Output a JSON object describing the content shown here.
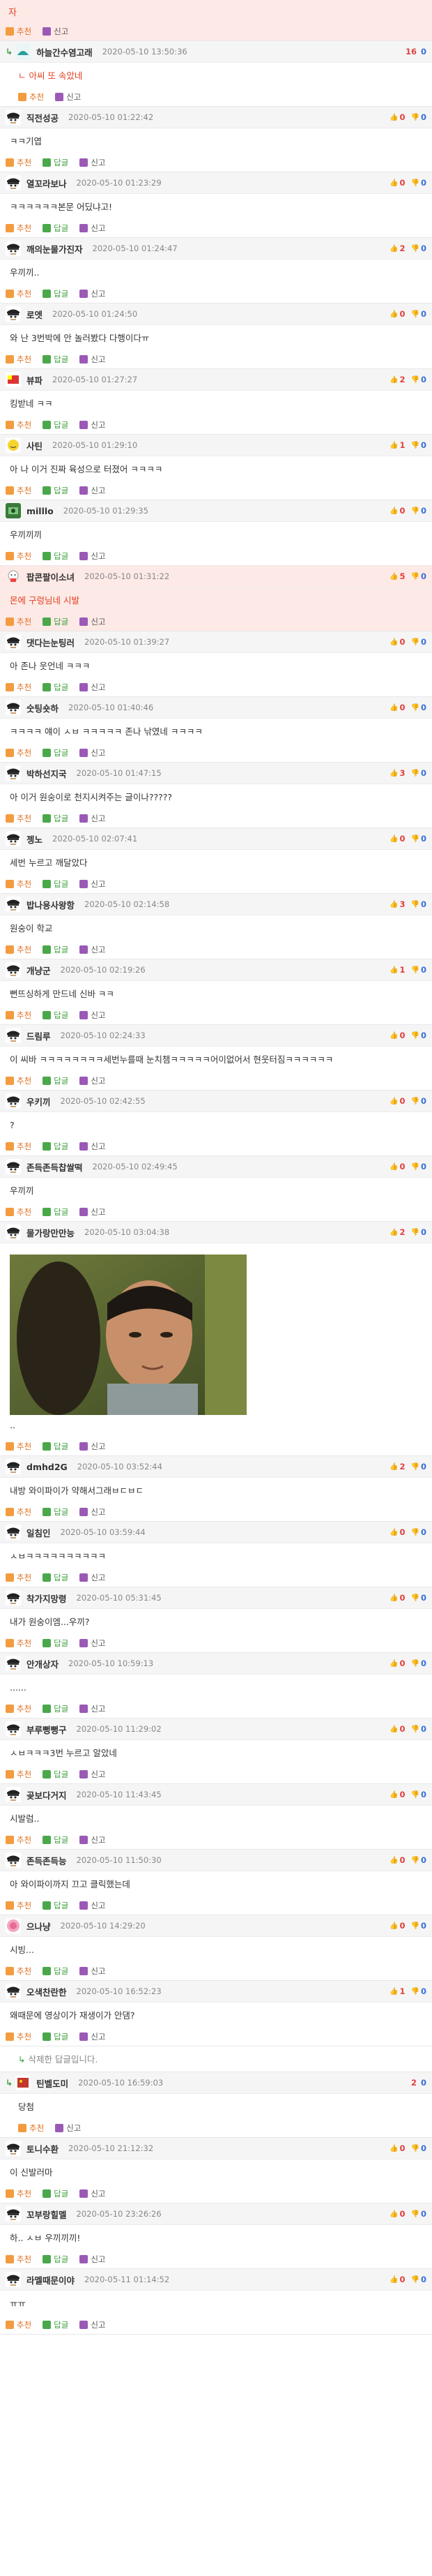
{
  "top_partial": {
    "text": "자"
  },
  "labels": {
    "recommend": "추천",
    "reply": "답글",
    "report": "신고"
  },
  "comments": [
    {
      "id": "c1",
      "reply": false,
      "highlight": true,
      "nick": "",
      "date": "",
      "votes": null,
      "count": null,
      "body": "",
      "actions": [
        "recommend",
        "report"
      ],
      "avatar": "none"
    },
    {
      "id": "c2",
      "reply": true,
      "highlight": false,
      "nick": "하늘간수염고래",
      "date": "2020-05-10 13:50:36",
      "count": "16",
      "count2": "0",
      "votes": "plain",
      "body": "ㄴ 아씨 또 속았네",
      "bodyClass": "red",
      "actions": [
        "recommend",
        "report"
      ],
      "avatar": "whale"
    },
    {
      "id": "c3",
      "nick": "직전성공",
      "date": "2020-05-10 01:22:42",
      "up": "0",
      "down": "0",
      "body": "ㅋㅋ기엽",
      "actions": [
        "recommend",
        "reply",
        "report"
      ],
      "avatar": "dark"
    },
    {
      "id": "c4",
      "nick": "열꼬라보나",
      "date": "2020-05-10 01:23:29",
      "up": "0",
      "down": "0",
      "body": "ㅋㅋㅋㅋㅋㅋ본문 어딨냐고!",
      "actions": [
        "recommend",
        "reply",
        "report"
      ],
      "avatar": "dark"
    },
    {
      "id": "c5",
      "nick": "깨의눈물가진자",
      "date": "2020-05-10 01:24:47",
      "up": "2",
      "down": "0",
      "body": "우끼끼..",
      "actions": [
        "recommend",
        "reply",
        "report"
      ],
      "avatar": "dark"
    },
    {
      "id": "c6",
      "nick": "로엣",
      "date": "2020-05-10 01:24:50",
      "up": "0",
      "down": "0",
      "body": "와 난 3번박에 안 놀러봤다 다행이다ㅠ",
      "actions": [
        "recommend",
        "reply",
        "report"
      ],
      "avatar": "dark"
    },
    {
      "id": "c7",
      "nick": "뷰파",
      "date": "2020-05-10 01:27:27",
      "up": "2",
      "down": "0",
      "body": "킹받네 ㅋㅋ",
      "actions": [
        "recommend",
        "reply",
        "report"
      ],
      "avatar": "flag"
    },
    {
      "id": "c8",
      "nick": "사틴",
      "date": "2020-05-10 01:29:10",
      "up": "1",
      "down": "0",
      "body": "아 나 이거 진짜 육성으로 터졌어 ㅋㅋㅋㅋ",
      "actions": [
        "recommend",
        "reply",
        "report"
      ],
      "avatar": "yellow"
    },
    {
      "id": "c9",
      "nick": "milllo",
      "date": "2020-05-10 01:29:35",
      "up": "0",
      "down": "0",
      "body": "우끼끼끼",
      "actions": [
        "recommend",
        "reply",
        "report"
      ],
      "avatar": "green"
    },
    {
      "id": "c10",
      "highlight": true,
      "nick": "팝콘팔이소녀",
      "date": "2020-05-10 01:31:22",
      "up": "5",
      "down": "0",
      "body": "몬에 구렁님네 시발",
      "bodyClass": "red",
      "actions": [
        "recommend",
        "reply",
        "report"
      ],
      "avatar": "popcorn"
    },
    {
      "id": "c11",
      "nick": "댓다는눈팅러",
      "date": "2020-05-10 01:39:27",
      "up": "0",
      "down": "0",
      "body": "아 존나 웃언네 ㅋㅋㅋ",
      "actions": [
        "recommend",
        "reply",
        "report"
      ],
      "avatar": "dark"
    },
    {
      "id": "c12",
      "nick": "숫팅숏하",
      "date": "2020-05-10 01:40:46",
      "up": "0",
      "down": "0",
      "body": "ㅋㅋㅋㅋ 얘이 ㅅㅂ ㅋㅋㅋㅋㅋ 존나 낚였네 ㅋㅋㅋㅋ",
      "actions": [
        "recommend",
        "reply",
        "report"
      ],
      "avatar": "dark"
    },
    {
      "id": "c13",
      "nick": "박하선지국",
      "date": "2020-05-10 01:47:15",
      "up": "3",
      "down": "0",
      "body": "아 이거 원숭이로 천지시켜주는 글이나?????",
      "actions": [
        "recommend",
        "reply",
        "report"
      ],
      "avatar": "dark"
    },
    {
      "id": "c14",
      "nick": "젱노",
      "date": "2020-05-10 02:07:41",
      "up": "0",
      "down": "0",
      "body": "세번 누르고 깨달았다",
      "actions": [
        "recommend",
        "reply",
        "report"
      ],
      "avatar": "dark"
    },
    {
      "id": "c15",
      "nick": "밥나용사왕항",
      "date": "2020-05-10 02:14:58",
      "up": "3",
      "down": "0",
      "body": "원숭이 학교",
      "actions": [
        "recommend",
        "reply",
        "report"
      ],
      "avatar": "dark"
    },
    {
      "id": "c16",
      "nick": "개냥군",
      "date": "2020-05-10 02:19:26",
      "up": "1",
      "down": "0",
      "body": "뻔뜨싱하게 만드네 신바 ㅋㅋ",
      "actions": [
        "recommend",
        "reply",
        "report"
      ],
      "avatar": "dark"
    },
    {
      "id": "c17",
      "nick": "드림루",
      "date": "2020-05-10 02:24:33",
      "up": "0",
      "down": "0",
      "body": "이 씨바 ㅋㅋㅋㅋㅋㅋㅋㅋ세번누를때 눈치챔ㅋㅋㅋㅋㅋ어이없어서 현웃터짐ㅋㅋㅋㅋㅋㅋ",
      "actions": [
        "recommend",
        "reply",
        "report"
      ],
      "avatar": "dark"
    },
    {
      "id": "c18",
      "nick": "우키끼",
      "date": "2020-05-10 02:42:55",
      "up": "0",
      "down": "0",
      "body": "?",
      "actions": [
        "recommend",
        "reply",
        "report"
      ],
      "avatar": "dark"
    },
    {
      "id": "c19",
      "nick": "존득존득찹쌀떡",
      "date": "2020-05-10 02:49:45",
      "up": "0",
      "down": "0",
      "body": "우끼끼",
      "actions": [
        "recommend",
        "reply",
        "report"
      ],
      "avatar": "dark"
    },
    {
      "id": "c20",
      "nick": "물가랑만만능",
      "date": "2020-05-10 03:04:38",
      "up": "2",
      "down": "0",
      "body": "..",
      "image": true,
      "actions": [
        "recommend",
        "reply",
        "report"
      ],
      "avatar": "dark"
    },
    {
      "id": "c21",
      "nick": "dmhd2G",
      "date": "2020-05-10 03:52:44",
      "up": "2",
      "down": "0",
      "body": "내방 와이파이가 약해서그래ㅂㄷㅂㄷ",
      "actions": [
        "recommend",
        "reply",
        "report"
      ],
      "avatar": "dark"
    },
    {
      "id": "c22",
      "nick": "일침인",
      "date": "2020-05-10 03:59:44",
      "up": "0",
      "down": "0",
      "body": "ㅅㅂㅋㅋㅋㅋㅋㅋㅋㅋㅋㅋ",
      "actions": [
        "recommend",
        "reply",
        "report"
      ],
      "avatar": "dark"
    },
    {
      "id": "c23",
      "nick": "착가지망령",
      "date": "2020-05-10 05:31:45",
      "up": "0",
      "down": "0",
      "body": "내가 원숭이엠...우끼?",
      "actions": [
        "recommend",
        "reply",
        "report"
      ],
      "avatar": "dark"
    },
    {
      "id": "c24",
      "nick": "안개상자",
      "date": "2020-05-10 10:59:13",
      "up": "0",
      "down": "0",
      "body": "......",
      "actions": [
        "recommend",
        "reply",
        "report"
      ],
      "avatar": "dark"
    },
    {
      "id": "c25",
      "nick": "부루뻥뻥구",
      "date": "2020-05-10 11:29:02",
      "up": "0",
      "down": "0",
      "body": "ㅅㅂㅋㅋㅋ3번 누르고 알았네",
      "actions": [
        "recommend",
        "reply",
        "report"
      ],
      "avatar": "dark"
    },
    {
      "id": "c26",
      "nick": "곶보다거지",
      "date": "2020-05-10 11:43:45",
      "up": "0",
      "down": "0",
      "body": "시발럼..",
      "actions": [
        "recommend",
        "reply",
        "report"
      ],
      "avatar": "dark"
    },
    {
      "id": "c27",
      "nick": "존득존득능",
      "date": "2020-05-10 11:50:30",
      "up": "0",
      "down": "0",
      "body": "아 와이파이까지 끄고 클릭했는데",
      "actions": [
        "recommend",
        "reply",
        "report"
      ],
      "avatar": "dark"
    },
    {
      "id": "c28",
      "nick": "으나냥",
      "date": "2020-05-10 14:29:20",
      "up": "0",
      "down": "0",
      "body": "시빙...",
      "actions": [
        "recommend",
        "reply",
        "report"
      ],
      "avatar": "pink"
    },
    {
      "id": "c29",
      "nick": "오색찬란한",
      "date": "2020-05-10 16:52:23",
      "up": "1",
      "down": "0",
      "body": "왜때문에 영상이가 재생이가 안댐?",
      "actions": [
        "recommend",
        "reply",
        "report"
      ],
      "avatar": "dark"
    },
    {
      "id": "c30",
      "reply": true,
      "deleted": true,
      "nick": "",
      "date": "",
      "body": "삭제한 답글입니다.",
      "bodyClass": "grey",
      "actions": [],
      "avatar": "none"
    },
    {
      "id": "c31",
      "reply": true,
      "nick": "틴벨도미",
      "date": "2020-05-10 16:59:03",
      "count": "2",
      "count2": "0",
      "votes": "plain",
      "body": "당첨",
      "actions": [
        "recommend",
        "report"
      ],
      "avatar": "redflag"
    },
    {
      "id": "c32",
      "nick": "토니수환",
      "date": "2020-05-10 21:12:32",
      "up": "0",
      "down": "0",
      "body": "이 신발러마",
      "actions": [
        "recommend",
        "reply",
        "report"
      ],
      "avatar": "dark"
    },
    {
      "id": "c33",
      "nick": "꼬부랑힐멜",
      "date": "2020-05-10 23:26:26",
      "up": "0",
      "down": "0",
      "body": "하.. ㅅㅂ 우끼끼끼!",
      "actions": [
        "recommend",
        "reply",
        "report"
      ],
      "avatar": "dark"
    },
    {
      "id": "c34",
      "nick": "라멜때문이야",
      "date": "2020-05-11 01:14:52",
      "up": "0",
      "down": "0",
      "body": "ㅠㅠ",
      "actions": [
        "recommend",
        "reply",
        "report"
      ],
      "avatar": "dark"
    }
  ],
  "colors": {
    "highlight": "#fde9e6",
    "recommend": "#f39c3f",
    "reply": "#4aa84a",
    "report": "#9b59b6",
    "up": "#e04040",
    "down": "#3a6fd8"
  }
}
